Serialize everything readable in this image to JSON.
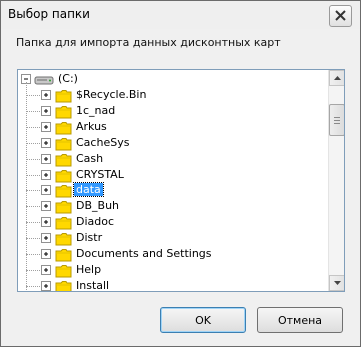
{
  "dialog": {
    "title": "Выбор папки",
    "description": "Папка для импорта данных дисконтных карт",
    "ok_label": "OK",
    "cancel_label": "Отмена"
  },
  "tree": {
    "root": {
      "label": "(C:)",
      "expanded": true,
      "icon": "drive-icon"
    },
    "folders": [
      {
        "label": "$Recycle.Bin"
      },
      {
        "label": "1c_nad"
      },
      {
        "label": "Arkus"
      },
      {
        "label": "CacheSys"
      },
      {
        "label": "Cash"
      },
      {
        "label": "CRYSTAL"
      },
      {
        "label": "data",
        "selected": true
      },
      {
        "label": "DB_Buh"
      },
      {
        "label": "Diadoc"
      },
      {
        "label": "Distr"
      },
      {
        "label": "Documents and Settings"
      },
      {
        "label": "Help"
      },
      {
        "label": "Install"
      }
    ]
  },
  "colors": {
    "selection": "#3399ff",
    "folder": "#ffd800",
    "window_bg": "#f0f0f0"
  }
}
